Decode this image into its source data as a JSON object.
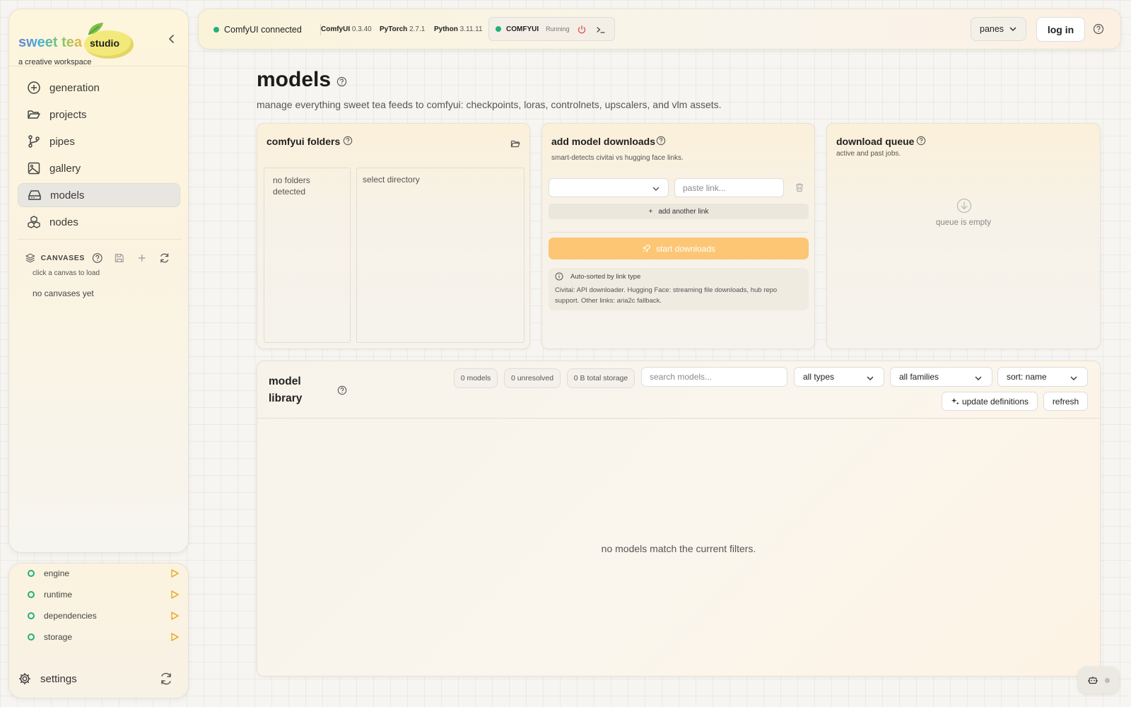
{
  "brand": {
    "name_left": "sweet tea",
    "name_right": "studio",
    "tagline": "a creative workspace"
  },
  "nav": {
    "items": [
      {
        "label": "generation",
        "icon": "plus-circle-icon"
      },
      {
        "label": "projects",
        "icon": "folder-open-icon"
      },
      {
        "label": "pipes",
        "icon": "git-branch-icon"
      },
      {
        "label": "gallery",
        "icon": "image-icon"
      },
      {
        "label": "models",
        "icon": "hard-drive-icon",
        "active": true
      },
      {
        "label": "nodes",
        "icon": "boxes-icon"
      }
    ]
  },
  "canvases": {
    "label": "CANVASES",
    "hint": "click a canvas to load",
    "empty": "no canvases yet"
  },
  "status": {
    "items": [
      {
        "label": "engine",
        "status_color": "#22b07a"
      },
      {
        "label": "runtime",
        "status_color": "#22b07a"
      },
      {
        "label": "dependencies",
        "status_color": "#22b07a"
      },
      {
        "label": "storage",
        "status_color": "#22b07a"
      }
    ],
    "settings_label": "settings"
  },
  "topbar": {
    "connection": "ComfyUI connected",
    "versions": [
      {
        "name": "ComfyUI",
        "value": "0.3.40"
      },
      {
        "name": "PyTorch",
        "value": "2.7.1"
      },
      {
        "name": "Python",
        "value": "3.11.11"
      }
    ],
    "engine": {
      "name": "COMFYUI",
      "state": "Running"
    },
    "panes_label": "panes",
    "login_label": "log in"
  },
  "page": {
    "title": "models",
    "subtitle": "manage everything sweet tea feeds to comfyui: checkpoints, loras, controlnets, upscalers, and vlm assets."
  },
  "folders": {
    "title": "comfyui folders",
    "empty": "no folders detected",
    "select": "select directory"
  },
  "downloads": {
    "title": "add model downloads",
    "subtitle": "smart-detects civitai vs hugging face links.",
    "type_value": "",
    "link_placeholder": "paste link...",
    "add_link": "add another link",
    "start": "start downloads",
    "info_title": "Auto-sorted by link type",
    "info_body": "Civitai: API downloader. Hugging Face: streaming file downloads, hub repo support. Other links: aria2c fallback."
  },
  "queue": {
    "title": "download queue",
    "subtitle": "active and past jobs.",
    "empty": "queue is empty"
  },
  "library": {
    "title": "model library",
    "stats": {
      "models": "0 models",
      "unresolved": "0 unresolved",
      "storage": "0 B total storage"
    },
    "search_placeholder": "search models...",
    "type_filter": "all types",
    "family_filter": "all families",
    "sort": "sort: name",
    "update_label": "update definitions",
    "refresh_label": "refresh",
    "empty": "no models match the current filters."
  },
  "colors": {
    "accent": "#fcc675",
    "ok": "#22b07a",
    "warn": "#e7a317",
    "power": "#e05050"
  }
}
